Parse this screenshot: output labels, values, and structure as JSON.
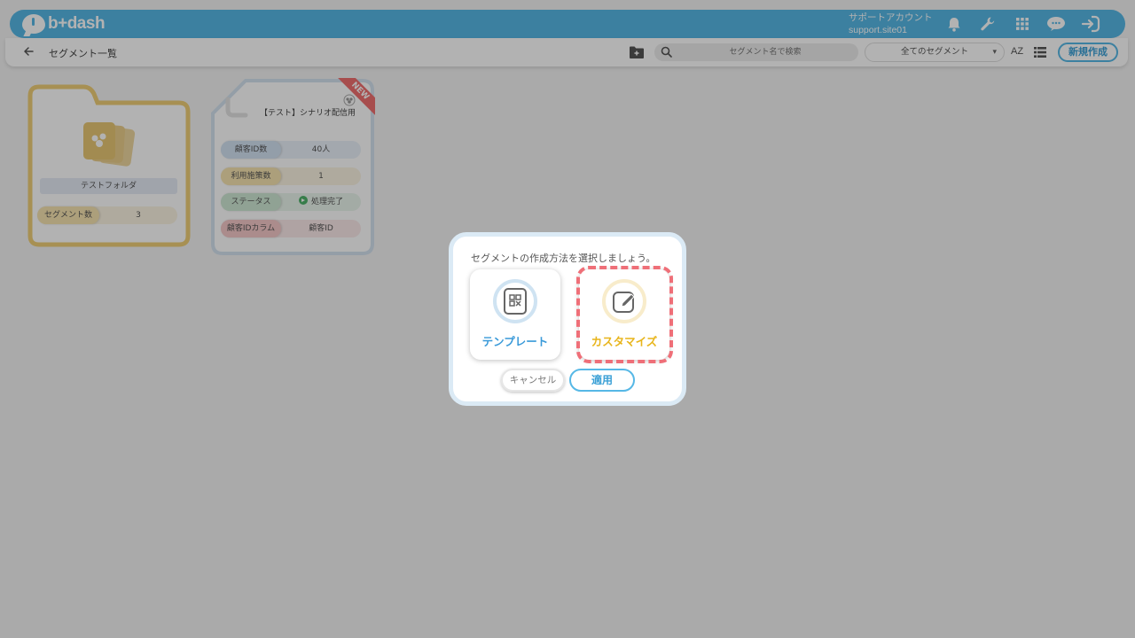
{
  "header": {
    "logo_text": "b+dash",
    "account_name": "サポートアカウント",
    "account_id": "support.site01",
    "icons": [
      "bell-icon",
      "wrench-icon",
      "apps-grid-icon",
      "chat-icon",
      "logout-icon"
    ]
  },
  "subbar": {
    "breadcrumb": "セグメント一覧",
    "search_placeholder": "セグメント名で検索",
    "segment_filter": "全てのセグメント",
    "sort_label": "AZ",
    "new_button": "新規作成"
  },
  "folder_card": {
    "name": "テストフォルダ",
    "count_label": "セグメント数",
    "count_value": "3",
    "color": "#f0cf78"
  },
  "segment_card": {
    "title": "【テスト】シナリオ配信用",
    "badge": "NEW",
    "rows": [
      {
        "label": "顧客ID数",
        "value": "40人"
      },
      {
        "label": "利用施策数",
        "value": "1"
      },
      {
        "label": "ステータス",
        "value": "処理完了"
      },
      {
        "label": "顧客IDカラム",
        "value": "顧客ID"
      }
    ]
  },
  "modal": {
    "message": "セグメントの作成方法を選択しましょう。",
    "options": [
      {
        "label": "テンプレート",
        "color": "#3a9ad9"
      },
      {
        "label": "カスタマイズ",
        "color": "#e8b51c"
      }
    ],
    "cancel_label": "キャンセル",
    "apply_label": "適用"
  },
  "colors": {
    "brand": "#56b8e6",
    "highlight": "#ef6f78"
  }
}
